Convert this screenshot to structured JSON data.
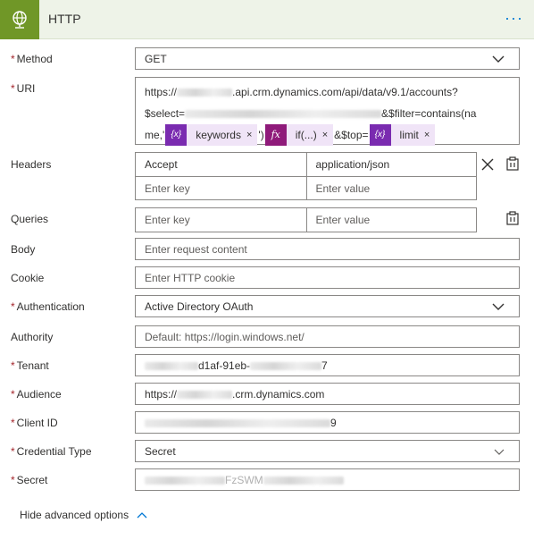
{
  "header": {
    "title": "HTTP",
    "more_label": "···",
    "accent_color": "#709727"
  },
  "labels": {
    "method": "Method",
    "uri": "URI",
    "headers": "Headers",
    "queries": "Queries",
    "body": "Body",
    "cookie": "Cookie",
    "authentication": "Authentication",
    "authority": "Authority",
    "tenant": "Tenant",
    "audience": "Audience",
    "client_id": "Client ID",
    "credential_type": "Credential Type",
    "secret": "Secret",
    "required_mark": "*"
  },
  "method": {
    "value": "GET"
  },
  "uri": {
    "line1_prefix": "https://",
    "line1_suffix": ".api.crm.dynamics.com/api/data/v9.1/accounts?",
    "line2_prefix": "$select=",
    "line2_suffix": "&$filter=contains(na",
    "line3_prefix": "me,'",
    "line3_mid": "')",
    "line3_top": "&$top=",
    "tokens": [
      {
        "icon": "{x}",
        "label": "keywords",
        "close": "×",
        "color": "#7a2bb0"
      },
      {
        "icon": "fx",
        "label": "if(...)",
        "close": "×",
        "color": "#8f1a7a"
      },
      {
        "icon": "{x}",
        "label": "limit",
        "close": "×",
        "color": "#7a2bb0"
      }
    ]
  },
  "headers": {
    "rows": [
      {
        "key": "Accept",
        "value": "application/json"
      },
      {
        "key": "Enter key",
        "value": "Enter value",
        "placeholder": true
      }
    ],
    "remove_label": "×"
  },
  "queries": {
    "key_placeholder": "Enter key",
    "value_placeholder": "Enter value"
  },
  "body": {
    "placeholder": "Enter request content"
  },
  "cookie": {
    "placeholder": "Enter HTTP cookie"
  },
  "authentication": {
    "value": "Active Directory OAuth"
  },
  "authority": {
    "placeholder": "Default: https://login.windows.net/"
  },
  "tenant": {
    "value_visible": "d1af-91eb-",
    "value_end": "7"
  },
  "audience": {
    "prefix": "https://",
    "suffix": ".crm.dynamics.com"
  },
  "client_id": {
    "value_end": "9"
  },
  "credential_type": {
    "value": "Secret"
  },
  "secret": {
    "value_mid": "FzSWM"
  },
  "footer": {
    "toggle_label": "Hide advanced options"
  }
}
